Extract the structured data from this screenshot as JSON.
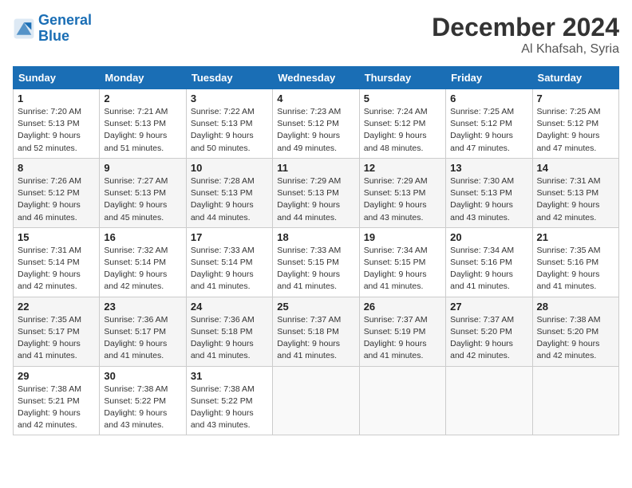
{
  "header": {
    "logo_line1": "General",
    "logo_line2": "Blue",
    "month_year": "December 2024",
    "location": "Al Khafsah, Syria"
  },
  "weekdays": [
    "Sunday",
    "Monday",
    "Tuesday",
    "Wednesday",
    "Thursday",
    "Friday",
    "Saturday"
  ],
  "weeks": [
    [
      {
        "day": 1,
        "sunrise": "7:20 AM",
        "sunset": "5:13 PM",
        "daylight": "9 hours and 52 minutes."
      },
      {
        "day": 2,
        "sunrise": "7:21 AM",
        "sunset": "5:13 PM",
        "daylight": "9 hours and 51 minutes."
      },
      {
        "day": 3,
        "sunrise": "7:22 AM",
        "sunset": "5:13 PM",
        "daylight": "9 hours and 50 minutes."
      },
      {
        "day": 4,
        "sunrise": "7:23 AM",
        "sunset": "5:12 PM",
        "daylight": "9 hours and 49 minutes."
      },
      {
        "day": 5,
        "sunrise": "7:24 AM",
        "sunset": "5:12 PM",
        "daylight": "9 hours and 48 minutes."
      },
      {
        "day": 6,
        "sunrise": "7:25 AM",
        "sunset": "5:12 PM",
        "daylight": "9 hours and 47 minutes."
      },
      {
        "day": 7,
        "sunrise": "7:25 AM",
        "sunset": "5:12 PM",
        "daylight": "9 hours and 47 minutes."
      }
    ],
    [
      {
        "day": 8,
        "sunrise": "7:26 AM",
        "sunset": "5:12 PM",
        "daylight": "9 hours and 46 minutes."
      },
      {
        "day": 9,
        "sunrise": "7:27 AM",
        "sunset": "5:13 PM",
        "daylight": "9 hours and 45 minutes."
      },
      {
        "day": 10,
        "sunrise": "7:28 AM",
        "sunset": "5:13 PM",
        "daylight": "9 hours and 44 minutes."
      },
      {
        "day": 11,
        "sunrise": "7:29 AM",
        "sunset": "5:13 PM",
        "daylight": "9 hours and 44 minutes."
      },
      {
        "day": 12,
        "sunrise": "7:29 AM",
        "sunset": "5:13 PM",
        "daylight": "9 hours and 43 minutes."
      },
      {
        "day": 13,
        "sunrise": "7:30 AM",
        "sunset": "5:13 PM",
        "daylight": "9 hours and 43 minutes."
      },
      {
        "day": 14,
        "sunrise": "7:31 AM",
        "sunset": "5:13 PM",
        "daylight": "9 hours and 42 minutes."
      }
    ],
    [
      {
        "day": 15,
        "sunrise": "7:31 AM",
        "sunset": "5:14 PM",
        "daylight": "9 hours and 42 minutes."
      },
      {
        "day": 16,
        "sunrise": "7:32 AM",
        "sunset": "5:14 PM",
        "daylight": "9 hours and 42 minutes."
      },
      {
        "day": 17,
        "sunrise": "7:33 AM",
        "sunset": "5:14 PM",
        "daylight": "9 hours and 41 minutes."
      },
      {
        "day": 18,
        "sunrise": "7:33 AM",
        "sunset": "5:15 PM",
        "daylight": "9 hours and 41 minutes."
      },
      {
        "day": 19,
        "sunrise": "7:34 AM",
        "sunset": "5:15 PM",
        "daylight": "9 hours and 41 minutes."
      },
      {
        "day": 20,
        "sunrise": "7:34 AM",
        "sunset": "5:16 PM",
        "daylight": "9 hours and 41 minutes."
      },
      {
        "day": 21,
        "sunrise": "7:35 AM",
        "sunset": "5:16 PM",
        "daylight": "9 hours and 41 minutes."
      }
    ],
    [
      {
        "day": 22,
        "sunrise": "7:35 AM",
        "sunset": "5:17 PM",
        "daylight": "9 hours and 41 minutes."
      },
      {
        "day": 23,
        "sunrise": "7:36 AM",
        "sunset": "5:17 PM",
        "daylight": "9 hours and 41 minutes."
      },
      {
        "day": 24,
        "sunrise": "7:36 AM",
        "sunset": "5:18 PM",
        "daylight": "9 hours and 41 minutes."
      },
      {
        "day": 25,
        "sunrise": "7:37 AM",
        "sunset": "5:18 PM",
        "daylight": "9 hours and 41 minutes."
      },
      {
        "day": 26,
        "sunrise": "7:37 AM",
        "sunset": "5:19 PM",
        "daylight": "9 hours and 41 minutes."
      },
      {
        "day": 27,
        "sunrise": "7:37 AM",
        "sunset": "5:20 PM",
        "daylight": "9 hours and 42 minutes."
      },
      {
        "day": 28,
        "sunrise": "7:38 AM",
        "sunset": "5:20 PM",
        "daylight": "9 hours and 42 minutes."
      }
    ],
    [
      {
        "day": 29,
        "sunrise": "7:38 AM",
        "sunset": "5:21 PM",
        "daylight": "9 hours and 42 minutes."
      },
      {
        "day": 30,
        "sunrise": "7:38 AM",
        "sunset": "5:22 PM",
        "daylight": "9 hours and 43 minutes."
      },
      {
        "day": 31,
        "sunrise": "7:38 AM",
        "sunset": "5:22 PM",
        "daylight": "9 hours and 43 minutes."
      },
      null,
      null,
      null,
      null
    ]
  ]
}
